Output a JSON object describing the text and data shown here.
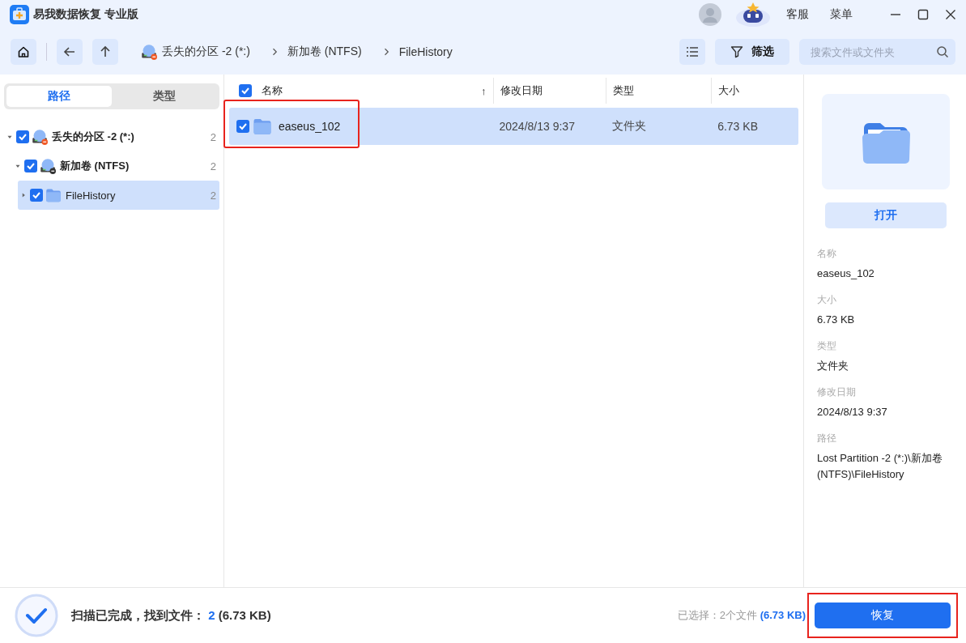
{
  "app": {
    "title": "易我数据恢复 专业版"
  },
  "title_bar": {
    "links": [
      "客服",
      "菜单"
    ]
  },
  "breadcrumb": [
    {
      "label": "丢失的分区 -2 (*:)",
      "kind": "drive"
    },
    {
      "label": "新加卷 (NTFS)",
      "kind": "plain"
    },
    {
      "label": "FileHistory",
      "kind": "plain"
    }
  ],
  "filter_button": "筛选",
  "search": {
    "placeholder": "搜索文件或文件夹"
  },
  "sidebar": {
    "tabs": [
      {
        "label": "路径",
        "selected": true
      },
      {
        "label": "类型",
        "selected": false
      }
    ],
    "tree": [
      {
        "label": "丢失的分区 -2 (*:)",
        "count": "2",
        "checked": true,
        "expanded": true,
        "selected": false,
        "kind": "lost-drive",
        "children": [
          {
            "label": "新加卷 (NTFS)",
            "count": "2",
            "checked": true,
            "expanded": true,
            "selected": false,
            "kind": "drive",
            "children": [
              {
                "label": "FileHistory",
                "count": "2",
                "checked": true,
                "expanded": false,
                "selected": true,
                "kind": "folder"
              }
            ]
          }
        ]
      }
    ]
  },
  "table": {
    "all_checked": true,
    "columns": [
      {
        "label": "名称",
        "sort": "↑"
      },
      {
        "label": "修改日期"
      },
      {
        "label": "类型"
      },
      {
        "label": "大小"
      }
    ],
    "rows": [
      {
        "name": "easeus_102",
        "date": "2024/8/13 9:37",
        "type": "文件夹",
        "size": "6.73 KB",
        "checked": true,
        "selected": true,
        "highlighted": true
      }
    ]
  },
  "details": {
    "open_button": "打开",
    "fields": [
      {
        "label": "名称",
        "value": "easeus_102"
      },
      {
        "label": "大小",
        "value": "6.73 KB"
      },
      {
        "label": "类型",
        "value": "文件夹"
      },
      {
        "label": "修改日期",
        "value": "2024/8/13 9:37"
      },
      {
        "label": "路径",
        "value": "Lost Partition -2 (*:)\\新加卷 (NTFS)\\FileHistory"
      }
    ]
  },
  "status": {
    "message": "扫描已完成，找到文件：",
    "count": "2",
    "size": "(6.73 KB)",
    "selected_label": "已选择：2个文件",
    "selected_size": "(6.73 KB)",
    "recover_button": {
      "label": "恢复",
      "highlighted": true
    }
  }
}
